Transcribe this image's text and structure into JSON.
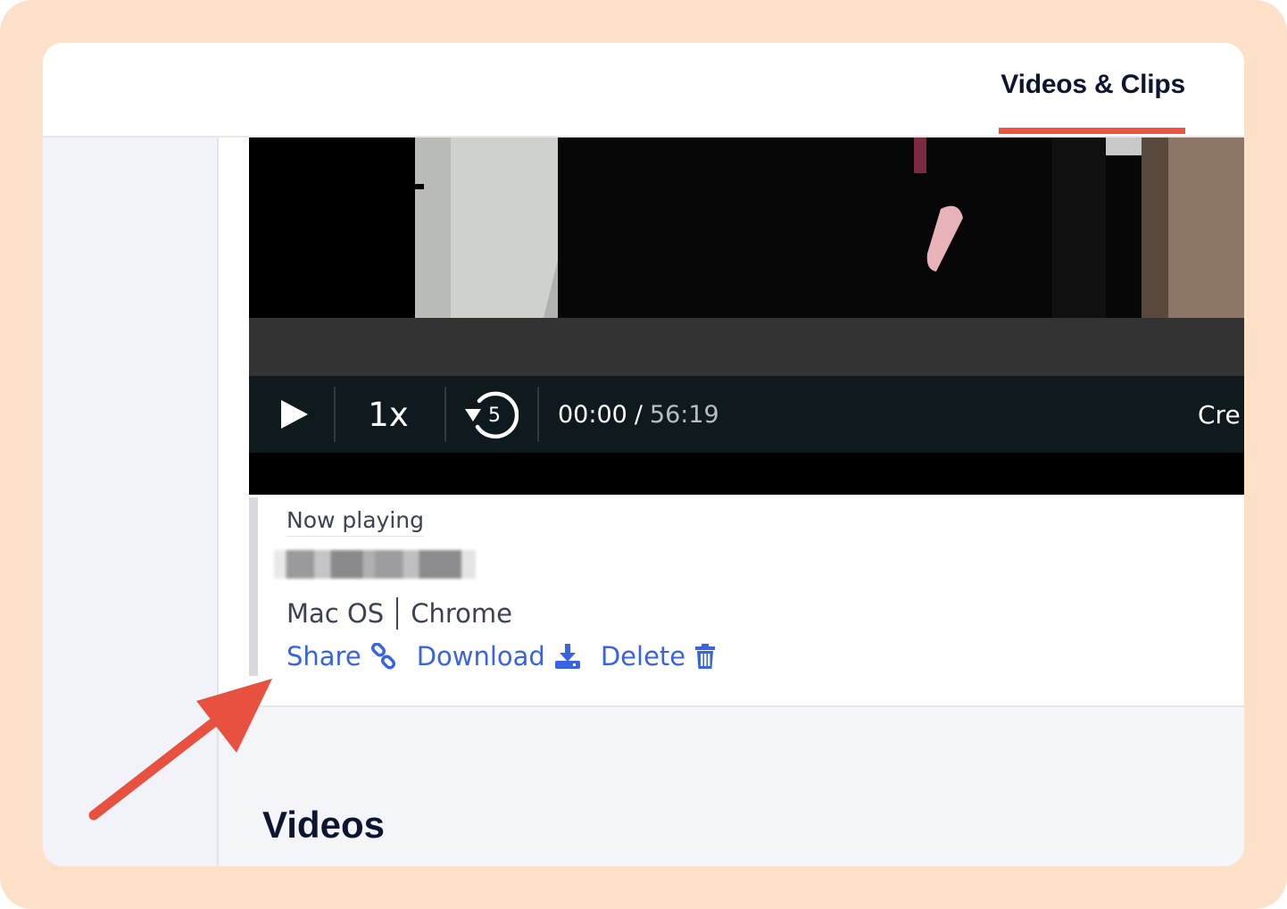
{
  "header": {
    "active_tab": "Videos & Clips"
  },
  "player": {
    "speed": "1x",
    "rewind_seconds": "5",
    "current_time": "00:00",
    "time_separator": "/",
    "duration": "56:19",
    "create_label": "Cre"
  },
  "now_playing": {
    "label": "Now playing",
    "os": "Mac OS",
    "browser": "Chrome"
  },
  "actions": {
    "share": "Share",
    "download": "Download",
    "delete": "Delete"
  },
  "section": {
    "heading": "Videos"
  },
  "colors": {
    "frame_bg": "#fde0c8",
    "accent": "#ee5341",
    "link": "#3a63e3",
    "control_bar": "#0f1a1e"
  },
  "icons": [
    "play-icon",
    "rewind-5-icon",
    "link-icon",
    "download-icon",
    "trash-icon",
    "arrow-annotation"
  ]
}
